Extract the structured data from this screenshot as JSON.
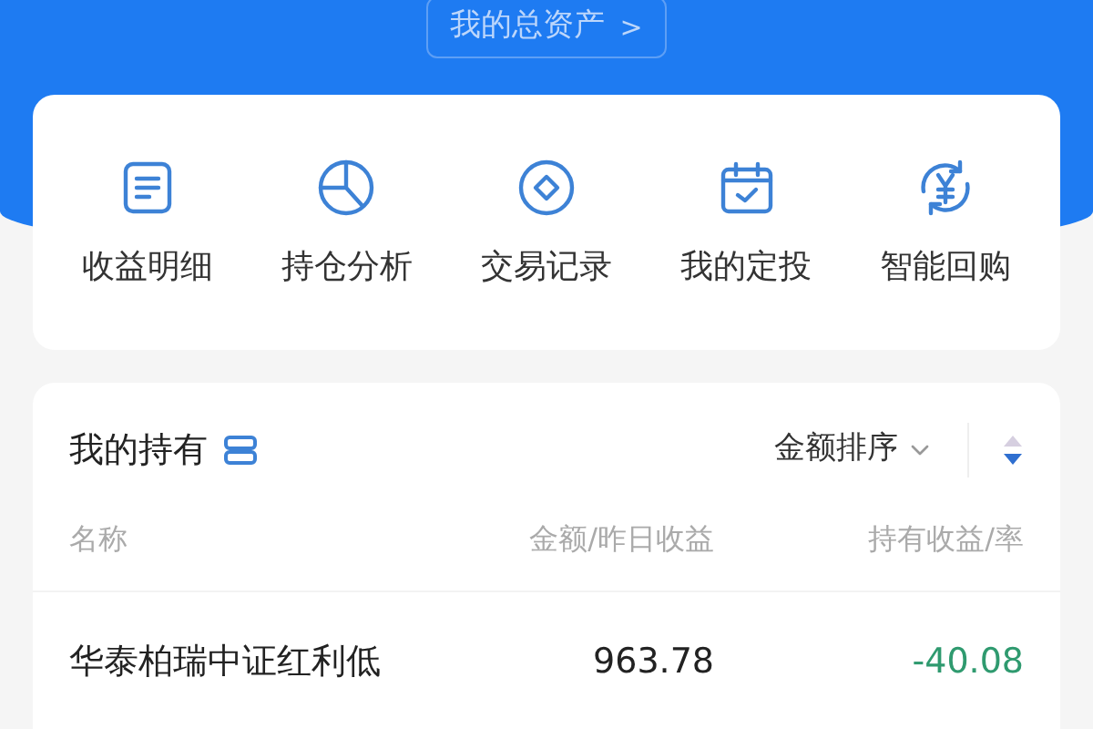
{
  "header": {
    "assets_button": "我的总资产",
    "chevron": ">"
  },
  "shortcuts": [
    {
      "label": "收益明细",
      "kind": "document"
    },
    {
      "label": "持仓分析",
      "kind": "pie"
    },
    {
      "label": "交易记录",
      "kind": "coin"
    },
    {
      "label": "我的定投",
      "kind": "calendar"
    },
    {
      "label": "智能回购",
      "kind": "yen"
    }
  ],
  "holdings": {
    "title": "我的持有",
    "sort_label": "金额排序",
    "columns": [
      "名称",
      "金额/昨日收益",
      "持有收益/率"
    ],
    "rows": [
      {
        "name": "华泰柏瑞中证红利低",
        "amount": "963.78",
        "profit": "-40.08"
      }
    ]
  }
}
